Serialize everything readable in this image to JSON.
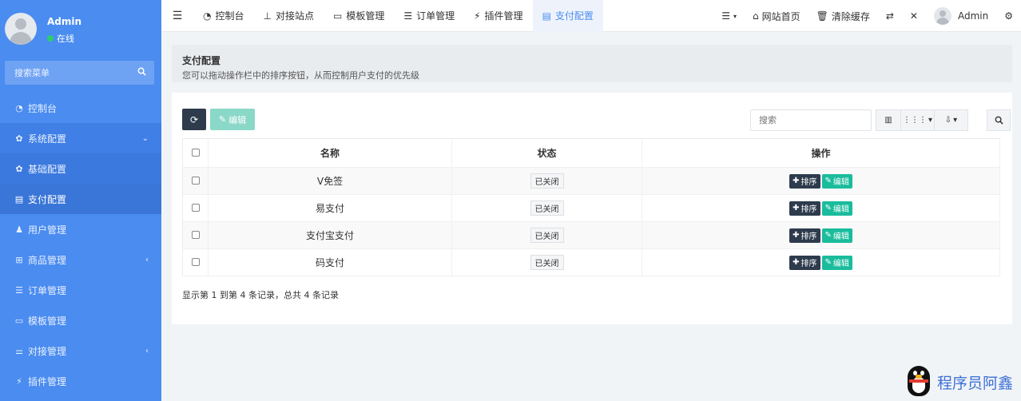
{
  "sidebar": {
    "user": {
      "name": "Admin",
      "status": "在线"
    },
    "search_placeholder": "搜索菜单",
    "items": [
      {
        "label": "控制台",
        "icon": "dashboard-icon"
      },
      {
        "label": "系统配置",
        "icon": "gear-icon"
      },
      {
        "label": "基础配置",
        "icon": "gear-icon"
      },
      {
        "label": "支付配置",
        "icon": "table-icon"
      },
      {
        "label": "用户管理",
        "icon": "user-icon"
      },
      {
        "label": "商品管理",
        "icon": "cart-icon"
      },
      {
        "label": "订单管理",
        "icon": "list-icon"
      },
      {
        "label": "模板管理",
        "icon": "template-icon"
      },
      {
        "label": "对接管理",
        "icon": "sliders-icon"
      },
      {
        "label": "插件管理",
        "icon": "plug-icon"
      }
    ]
  },
  "topnav": {
    "tabs": [
      {
        "label": "控制台"
      },
      {
        "label": "对接站点"
      },
      {
        "label": "模板管理"
      },
      {
        "label": "订单管理"
      },
      {
        "label": "插件管理"
      },
      {
        "label": "支付配置"
      }
    ],
    "right": {
      "site_home": "网站首页",
      "clear_cache": "清除缓存",
      "user": "Admin"
    }
  },
  "page": {
    "title": "支付配置",
    "description": "您可以拖动操作栏中的排序按钮，从而控制用户支付的优先级"
  },
  "toolbar": {
    "edit_label": "编辑",
    "search_placeholder": "搜索"
  },
  "table": {
    "headers": {
      "name": "名称",
      "status": "状态",
      "actions": "操作"
    },
    "rows": [
      {
        "name": "V免签",
        "status": "已关闭",
        "sort": "排序",
        "edit": "编辑"
      },
      {
        "name": "易支付",
        "status": "已关闭",
        "sort": "排序",
        "edit": "编辑"
      },
      {
        "name": "支付宝支付",
        "status": "已关闭",
        "sort": "排序",
        "edit": "编辑"
      },
      {
        "name": "码支付",
        "status": "已关闭",
        "sort": "排序",
        "edit": "编辑"
      }
    ]
  },
  "pagination": {
    "summary": "显示第 1 到第 4 条记录，总共 4 条记录"
  },
  "watermark": {
    "text": "程序员阿鑫"
  },
  "colors": {
    "sidebar_bg": "#4a8cf0",
    "dark_button": "#2d3b4d",
    "edit_button": "#1abc9c",
    "online": "#2ecc71"
  }
}
